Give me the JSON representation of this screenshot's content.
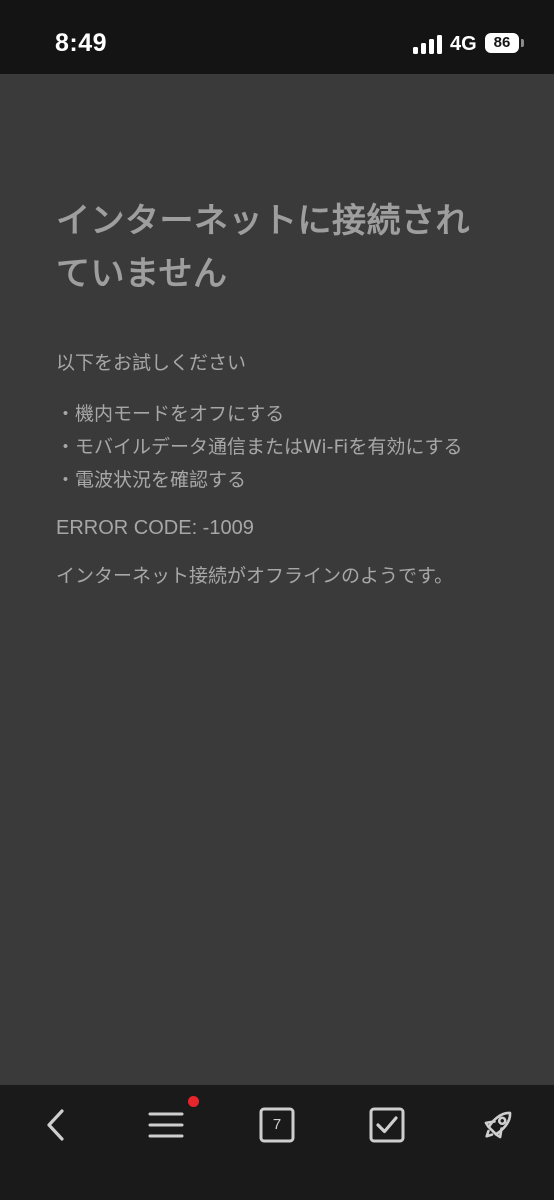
{
  "status_bar": {
    "time": "8:49",
    "network": "4G",
    "battery": "86"
  },
  "error_page": {
    "title_line1": "インターネットに接続され",
    "title_line2": "ていません",
    "suggest_heading": "以下をお試しください",
    "suggestions": [
      "・機内モードをオフにする",
      "・モバイルデータ通信またはWi-Fiを有効にする",
      "・電波状況を確認する"
    ],
    "error_code": "ERROR CODE: -1009",
    "message": "インターネット接続がオフラインのようです。"
  },
  "toolbar": {
    "items": [
      {
        "icon": "back-arrow-icon"
      },
      {
        "icon": "menu-icon",
        "badge_color": "#e8252b"
      },
      {
        "icon": "tabs-icon",
        "count": "7"
      },
      {
        "icon": "checkbox-icon"
      },
      {
        "icon": "rocket-icon"
      }
    ]
  },
  "colors": {
    "background": "#3a3a3a",
    "status_bar": "#141414",
    "toolbar": "#1a1a1a",
    "text": "#a7a7a7",
    "badge": "#e8252b"
  }
}
